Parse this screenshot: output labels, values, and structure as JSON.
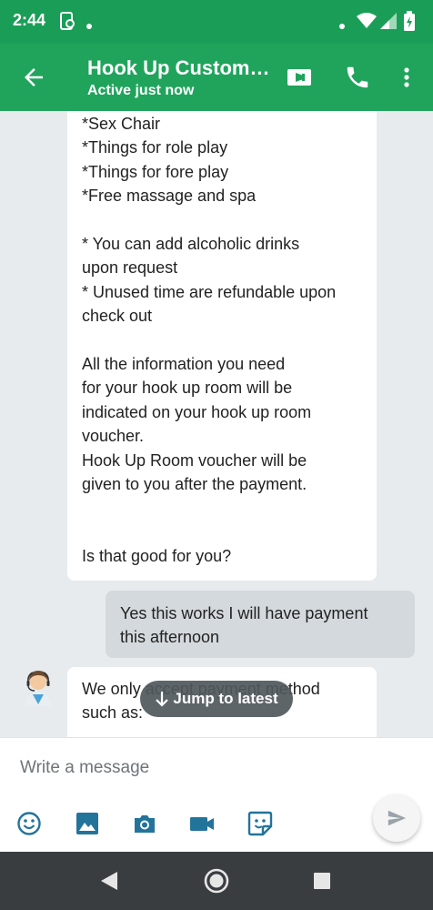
{
  "status_bar": {
    "time": "2:44"
  },
  "header": {
    "title": "Hook Up Custom…",
    "subtitle": "Active just now",
    "icons": [
      "back-arrow-icon",
      "video-call-icon",
      "phone-icon",
      "more-vert-icon"
    ]
  },
  "messages": [
    {
      "direction": "incoming",
      "lines": [
        "*Sex Chair",
        "*Things for role play",
        "*Things for fore play",
        "*Free massage and spa",
        "",
        "* You can add alcoholic drinks",
        "upon request",
        "* Unused time are refundable upon",
        "check out",
        "",
        "All the information you need",
        "for your hook up room will be",
        "indicated on your hook up room",
        "voucher.",
        "Hook Up Room voucher will be",
        "given to you after the payment.",
        "",
        "",
        "Is that good for you?"
      ]
    },
    {
      "direction": "outgoing",
      "lines": [
        "Yes this works I will have payment",
        "this afternoon"
      ]
    },
    {
      "direction": "incoming",
      "lines": [
        "We only accept payment method",
        "such as:"
      ]
    }
  ],
  "jump_to_latest": "Jump to latest",
  "composer": {
    "placeholder": "Write a message",
    "tools": [
      "emoji-icon",
      "image-icon",
      "camera-icon",
      "video-icon",
      "sticker-icon",
      "send-icon"
    ]
  },
  "colors": {
    "header_green": "#20a45c",
    "statusbar_green": "#1a9e57",
    "chat_bg": "#e8ebee",
    "outgoing_bubble": "#d4d9dd"
  }
}
